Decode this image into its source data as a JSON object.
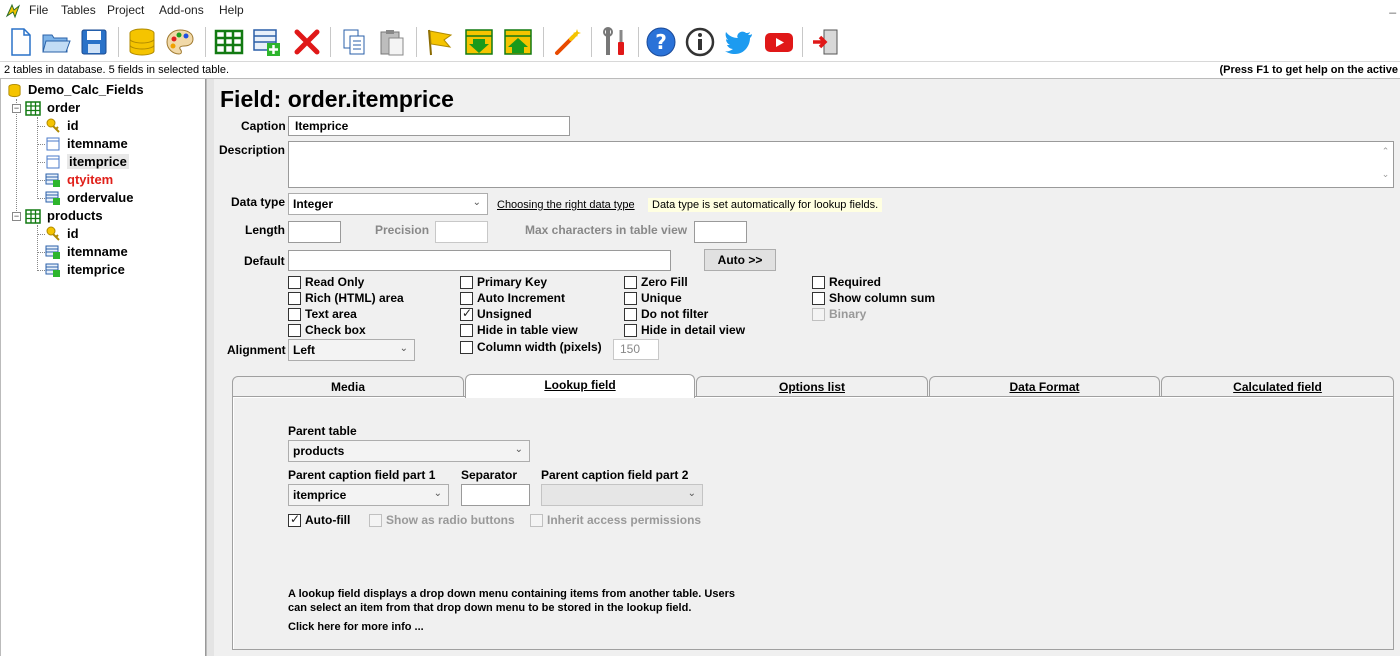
{
  "menu": {
    "items": [
      "File",
      "Tables",
      "Project",
      "Add-ons",
      "Help"
    ],
    "minimize": "_"
  },
  "toolbar": {
    "buttons": [
      "new-file",
      "open-folder",
      "save",
      "database",
      "palette",
      "table-grid",
      "add-table",
      "delete",
      "copy",
      "paste",
      "flag",
      "import",
      "export",
      "magic-wand",
      "tools",
      "help",
      "info",
      "twitter",
      "youtube",
      "exit"
    ]
  },
  "status": {
    "left": "2 tables in database. 5 fields in selected table.",
    "right": "(Press F1 to get help on the active"
  },
  "tree": {
    "root": "Demo_Calc_Fields",
    "tables": [
      {
        "name": "order",
        "fields": [
          "id",
          "itemname",
          "itemprice",
          "qtyitem",
          "ordervalue"
        ]
      },
      {
        "name": "products",
        "fields": [
          "id",
          "itemname",
          "itemprice"
        ]
      }
    ],
    "selected_field": "itemprice",
    "highlight_field": "qtyitem",
    "highlight_color": "#e0201a"
  },
  "field": {
    "title": "Field: order.itemprice",
    "caption_label": "Caption",
    "caption_value": "Itemprice",
    "description_label": "Description",
    "description_value": "",
    "datatype_label": "Data type",
    "datatype_value": "Integer",
    "datatype_link": "Choosing the right data type",
    "datatype_note": "Data type is set automatically for lookup fields.",
    "length_label": "Length",
    "precision_label": "Precision",
    "maxchars_label": "Max characters in table view",
    "default_label": "Default",
    "auto_button": "Auto >>",
    "alignment_label": "Alignment",
    "alignment_value": "Left",
    "colwidth_value": "150"
  },
  "checkboxes": {
    "read_only": "Read Only",
    "rich_html": "Rich (HTML) area",
    "text_area": "Text area",
    "check_box": "Check box",
    "primary_key": "Primary Key",
    "auto_increment": "Auto Increment",
    "unsigned": "Unsigned",
    "hide_table_view": "Hide in table view",
    "column_width": "Column width (pixels)",
    "zero_fill": "Zero Fill",
    "unique": "Unique",
    "do_not_filter": "Do not filter",
    "hide_detail_view": "Hide in detail view",
    "required": "Required",
    "show_column_sum": "Show column sum",
    "binary": "Binary"
  },
  "tabs": {
    "media": "Media",
    "lookup": "Lookup field",
    "options": "Options list",
    "dataformat": "Data Format",
    "calculated": "Calculated field"
  },
  "lookup": {
    "parent_table_label": "Parent table",
    "parent_table_value": "products",
    "caption1_label": "Parent caption field part 1",
    "caption1_value": "itemprice",
    "separator_label": "Separator",
    "separator_value": "",
    "caption2_label": "Parent caption field part 2",
    "caption2_value": "",
    "autofill": "Auto-fill",
    "radio_buttons": "Show as radio buttons",
    "inherit": "Inherit access permissions",
    "help_line1": "A lookup field displays a drop down menu containing items from another table. Users",
    "help_line2": "can select an item from that drop down menu to be stored in the lookup field.",
    "more_info": "Click here for more info ..."
  }
}
